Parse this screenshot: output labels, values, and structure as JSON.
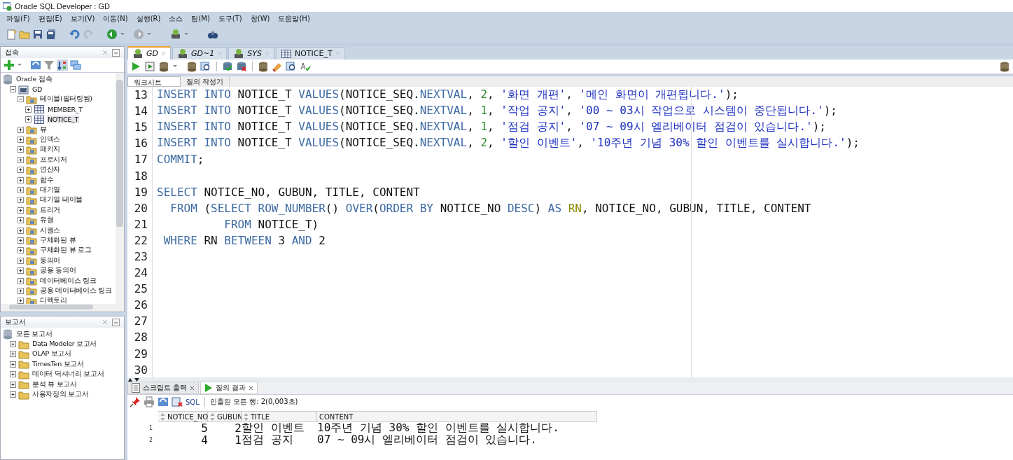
{
  "window": {
    "title": "Oracle SQL Developer : GD"
  },
  "menu": [
    "파일(F)",
    "편집(E)",
    "보기(V)",
    "이동(N)",
    "실행(R)",
    "소스",
    "팀(M)",
    "도구(T)",
    "창(W)",
    "도움말(H)"
  ],
  "connections_panel": {
    "title": "접속",
    "tree": [
      {
        "label": "Oracle 접속",
        "kind": "root",
        "selected": false,
        "children": [
          {
            "label": "GD",
            "kind": "connection",
            "expanded": true,
            "selected": false,
            "children": [
              {
                "label": "테이블(필터링됨)",
                "kind": "folder",
                "expanded": true,
                "selected": false,
                "children": [
                  {
                    "label": "MEMBER_T",
                    "kind": "table",
                    "expanded": false,
                    "selected": false
                  },
                  {
                    "label": "NOTICE_T",
                    "kind": "table",
                    "expanded": false,
                    "selected": true
                  }
                ]
              },
              {
                "label": "뷰",
                "kind": "folder",
                "expanded": false,
                "selected": false
              },
              {
                "label": "인덱스",
                "kind": "folder",
                "expanded": false,
                "selected": false
              },
              {
                "label": "패키지",
                "kind": "folder",
                "expanded": false,
                "selected": false
              },
              {
                "label": "프로시저",
                "kind": "folder",
                "expanded": false,
                "selected": false
              },
              {
                "label": "연산자",
                "kind": "folder",
                "expanded": false,
                "selected": false
              },
              {
                "label": "함수",
                "kind": "folder",
                "expanded": false,
                "selected": false
              },
              {
                "label": "대기열",
                "kind": "folder",
                "expanded": false,
                "selected": false
              },
              {
                "label": "대기열 테이블",
                "kind": "folder",
                "expanded": false,
                "selected": false
              },
              {
                "label": "트리거",
                "kind": "folder",
                "expanded": false,
                "selected": false
              },
              {
                "label": "유형",
                "kind": "folder",
                "expanded": false,
                "selected": false
              },
              {
                "label": "시퀀스",
                "kind": "folder",
                "expanded": false,
                "selected": false
              },
              {
                "label": "구체화된 뷰",
                "kind": "folder",
                "expanded": false,
                "selected": false
              },
              {
                "label": "구체화된 뷰 로그",
                "kind": "folder",
                "expanded": false,
                "selected": false
              },
              {
                "label": "동의어",
                "kind": "folder",
                "expanded": false,
                "selected": false
              },
              {
                "label": "공용 동의어",
                "kind": "folder",
                "expanded": false,
                "selected": false
              },
              {
                "label": "데이터베이스 링크",
                "kind": "folder",
                "expanded": false,
                "selected": false
              },
              {
                "label": "공용 데이터베이스 링크",
                "kind": "folder",
                "expanded": false,
                "selected": false
              },
              {
                "label": "디렉토리",
                "kind": "folder",
                "expanded": false,
                "selected": false
              }
            ]
          }
        ]
      }
    ]
  },
  "reports_panel": {
    "title": "보고서",
    "tree": [
      {
        "label": "모든 보고서",
        "kind": "root",
        "selected": false,
        "children": [
          {
            "label": "Data Modeler 보고서",
            "kind": "report",
            "expanded": false,
            "selected": false
          },
          {
            "label": "OLAP 보고서",
            "kind": "report",
            "expanded": false,
            "selected": false
          },
          {
            "label": "TimesTen 보고서",
            "kind": "report",
            "expanded": false,
            "selected": false
          },
          {
            "label": "데이터 딕셔너리 보고서",
            "kind": "report",
            "expanded": false,
            "selected": false
          },
          {
            "label": "분석 뷰 보고서",
            "kind": "report",
            "expanded": false,
            "selected": false
          },
          {
            "label": "사용자정의 보고서",
            "kind": "report",
            "expanded": false,
            "selected": false
          }
        ]
      }
    ]
  },
  "editor_tabs": [
    {
      "label": "GD",
      "kind": "connection",
      "selected": true
    },
    {
      "label": "GD~1",
      "kind": "connection",
      "selected": false
    },
    {
      "label": "SYS",
      "kind": "connection",
      "selected": false
    },
    {
      "label": "NOTICE_T",
      "kind": "table",
      "selected": false
    }
  ],
  "worksheet_tabs": [
    {
      "label": "워크시트",
      "selected": true
    },
    {
      "label": "질의 작성기",
      "selected": false
    }
  ],
  "code_lines": [
    {
      "number": "13",
      "tokens": [
        {
          "kind": "keyword",
          "text": "INSERT INTO "
        },
        {
          "kind": "name",
          "text": "NOTICE_T "
        },
        {
          "kind": "keyword",
          "text": "VALUES"
        },
        {
          "kind": "name",
          "text": "(NOTICE_SEQ."
        },
        {
          "kind": "keyword",
          "text": "NEXTVAL"
        },
        {
          "kind": "name",
          "text": ", "
        },
        {
          "kind": "number",
          "text": "2"
        },
        {
          "kind": "name",
          "text": ", "
        },
        {
          "kind": "string",
          "text": "'화면 개편'"
        },
        {
          "kind": "name",
          "text": ", "
        },
        {
          "kind": "string",
          "text": "'메인 화면이 개편됩니다.'"
        },
        {
          "kind": "name",
          "text": ");"
        }
      ]
    },
    {
      "number": "14",
      "tokens": [
        {
          "kind": "keyword",
          "text": "INSERT INTO "
        },
        {
          "kind": "name",
          "text": "NOTICE_T "
        },
        {
          "kind": "keyword",
          "text": "VALUES"
        },
        {
          "kind": "name",
          "text": "(NOTICE_SEQ."
        },
        {
          "kind": "keyword",
          "text": "NEXTVAL"
        },
        {
          "kind": "name",
          "text": ", "
        },
        {
          "kind": "number",
          "text": "1"
        },
        {
          "kind": "name",
          "text": ", "
        },
        {
          "kind": "string",
          "text": "'작업 공지'"
        },
        {
          "kind": "name",
          "text": ", "
        },
        {
          "kind": "string",
          "text": "'00 ~ 03시 작업으로 시스템이 중단됩니다.'"
        },
        {
          "kind": "name",
          "text": ");"
        }
      ]
    },
    {
      "number": "15",
      "tokens": [
        {
          "kind": "keyword",
          "text": "INSERT INTO "
        },
        {
          "kind": "name",
          "text": "NOTICE_T "
        },
        {
          "kind": "keyword",
          "text": "VALUES"
        },
        {
          "kind": "name",
          "text": "(NOTICE_SEQ."
        },
        {
          "kind": "keyword",
          "text": "NEXTVAL"
        },
        {
          "kind": "name",
          "text": ", "
        },
        {
          "kind": "number",
          "text": "1"
        },
        {
          "kind": "name",
          "text": ", "
        },
        {
          "kind": "string",
          "text": "'점검 공지'"
        },
        {
          "kind": "name",
          "text": ", "
        },
        {
          "kind": "string",
          "text": "'07 ~ 09시 엘리베이터 점검이 있습니다.'"
        },
        {
          "kind": "name",
          "text": ");"
        }
      ]
    },
    {
      "number": "16",
      "tokens": [
        {
          "kind": "keyword",
          "text": "INSERT INTO "
        },
        {
          "kind": "name",
          "text": "NOTICE_T "
        },
        {
          "kind": "keyword",
          "text": "VALUES"
        },
        {
          "kind": "name",
          "text": "(NOTICE_SEQ."
        },
        {
          "kind": "keyword",
          "text": "NEXTVAL"
        },
        {
          "kind": "name",
          "text": ", "
        },
        {
          "kind": "number",
          "text": "2"
        },
        {
          "kind": "name",
          "text": ", "
        },
        {
          "kind": "string",
          "text": "'할인 이벤트'"
        },
        {
          "kind": "name",
          "text": ", "
        },
        {
          "kind": "string",
          "text": "'10주년 기념 30% 할인 이벤트를 실시합니다.'"
        },
        {
          "kind": "name",
          "text": ");"
        }
      ]
    },
    {
      "number": "17",
      "tokens": [
        {
          "kind": "keyword",
          "text": "COMMIT"
        },
        {
          "kind": "name",
          "text": ";"
        }
      ]
    },
    {
      "number": "18"
    },
    {
      "number": "19",
      "tokens": [
        {
          "kind": "keyword",
          "text": "SELECT "
        },
        {
          "kind": "name",
          "text": "NOTICE_NO, GUBUN, TITLE, CONTENT"
        }
      ]
    },
    {
      "number": "20",
      "tokens": [
        {
          "kind": "keyword",
          "text": "  FROM "
        },
        {
          "kind": "name",
          "text": "("
        },
        {
          "kind": "keyword",
          "text": "SELECT ROW_NUMBER"
        },
        {
          "kind": "name",
          "text": "() "
        },
        {
          "kind": "keyword",
          "text": "OVER"
        },
        {
          "kind": "name",
          "text": "("
        },
        {
          "kind": "keyword",
          "text": "ORDER BY "
        },
        {
          "kind": "name",
          "text": "NOTICE_NO "
        },
        {
          "kind": "keyword",
          "text": "DESC"
        },
        {
          "kind": "name",
          "text": ") "
        },
        {
          "kind": "keyword",
          "text": "AS "
        },
        {
          "kind": "alias",
          "text": "RN"
        },
        {
          "kind": "name",
          "text": ", NOTICE_NO, GUBUN, TITLE, CONTENT"
        }
      ]
    },
    {
      "number": "21",
      "tokens": [
        {
          "kind": "keyword",
          "text": "          FROM "
        },
        {
          "kind": "name",
          "text": "NOTICE_T)"
        }
      ]
    },
    {
      "number": "22",
      "tokens": [
        {
          "kind": "keyword",
          "text": " WHERE "
        },
        {
          "kind": "name",
          "text": "RN "
        },
        {
          "kind": "keyword",
          "text": "BETWEEN "
        },
        {
          "kind": "name",
          "text": "3 "
        },
        {
          "kind": "keyword",
          "text": "AND "
        },
        {
          "kind": "name",
          "text": "2"
        }
      ]
    },
    {
      "number": "23"
    },
    {
      "number": "24"
    },
    {
      "number": "25"
    },
    {
      "number": "26"
    },
    {
      "number": "27"
    },
    {
      "number": "28"
    },
    {
      "number": "29"
    },
    {
      "number": "30"
    }
  ],
  "result_tabs": [
    {
      "label": "스크립트 출력",
      "kind": "script",
      "selected": false
    },
    {
      "label": "질의 결과",
      "kind": "query",
      "selected": true
    }
  ],
  "result_toolbar": {
    "sql_link": "SQL",
    "status": "인출된 모든 행: 2(0,003초)"
  },
  "result_grid": {
    "columns": [
      {
        "label": "NOTICE_NO",
        "sortable": true
      },
      {
        "label": "GUBUN",
        "sortable": true
      },
      {
        "label": "TITLE",
        "sortable": true
      },
      {
        "label": "CONTENT",
        "sortable": false
      }
    ],
    "rows": [
      {
        "number": "1",
        "cells": [
          "5",
          "2",
          "할인 이벤트",
          "10주년 기념 30% 할인 이벤트를 실시합니다."
        ]
      },
      {
        "number": "2",
        "cells": [
          "4",
          "1",
          "점검 공지",
          "07 ~ 09시 엘리베이터 점검이 있습니다."
        ]
      }
    ]
  }
}
